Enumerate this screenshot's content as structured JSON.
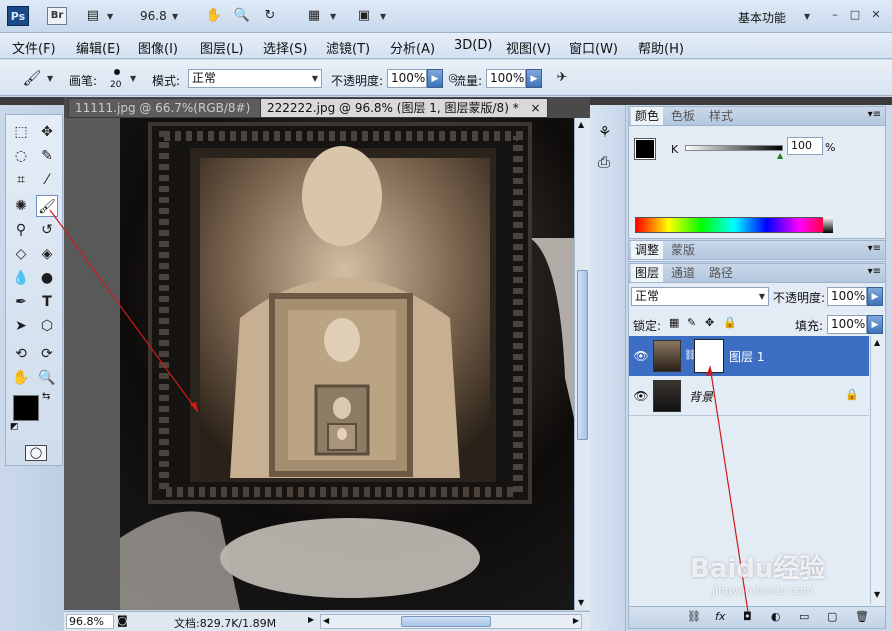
{
  "app": {
    "logo": "Ps",
    "bridge_logo": "Br",
    "zoom": "96.8",
    "workspace": "基本功能"
  },
  "menu": [
    "文件(F)",
    "编辑(E)",
    "图像(I)",
    "图层(L)",
    "选择(S)",
    "滤镜(T)",
    "分析(A)",
    "3D(D)",
    "视图(V)",
    "窗口(W)",
    "帮助(H)"
  ],
  "options": {
    "brush_label": "画笔:",
    "brush_size": "20",
    "mode_label": "模式:",
    "mode_value": "正常",
    "opacity_label": "不透明度:",
    "opacity_value": "100%",
    "flow_label": "流量:",
    "flow_value": "100%"
  },
  "documents": [
    {
      "label": "11111.jpg @ 66.7%(RGB/8#)",
      "close": "×"
    },
    {
      "label": "222222.jpg @ 96.8% (图层 1, 图层蒙版/8) *",
      "close": "×"
    }
  ],
  "status": {
    "zoom": "96.8%",
    "doc_size": "文档:829.7K/1.89M"
  },
  "color_panel": {
    "tabs": [
      "颜色",
      "色板",
      "样式"
    ],
    "channel": "K",
    "value": "100",
    "unit": "%"
  },
  "adjust_panel": {
    "tabs": [
      "调整",
      "蒙版"
    ]
  },
  "layers_panel": {
    "tabs": [
      "图层",
      "通道",
      "路径"
    ],
    "blend_mode": "正常",
    "opacity_label": "不透明度:",
    "opacity_value": "100%",
    "lock_label": "锁定:",
    "fill_label": "填充:",
    "fill_value": "100%",
    "layers": [
      {
        "name": "图层 1",
        "selected": true
      },
      {
        "name": "背景",
        "selected": false
      }
    ]
  },
  "watermark": {
    "line1": "Baidu经验",
    "line2": "jingyan.baidu.com"
  },
  "colors": {
    "selection_blue": "#3c6fc4",
    "annotation_red": "#d11a1a",
    "chrome": "#d3e0f0"
  }
}
